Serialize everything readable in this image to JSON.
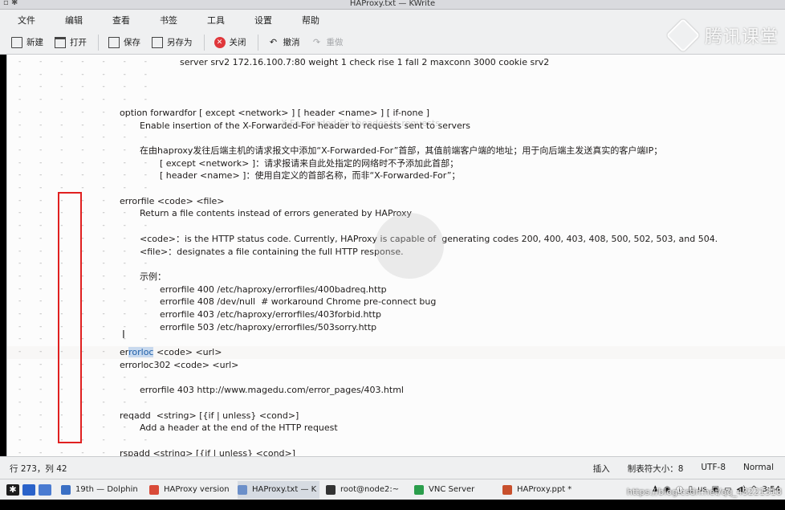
{
  "window": {
    "title": "HAProxy.txt — KWrite"
  },
  "menubar": [
    "文件",
    "编辑",
    "查看",
    "书签",
    "工具",
    "设置",
    "帮助"
  ],
  "toolbar": {
    "new": "新建",
    "open": "打开",
    "save": "保存",
    "save_as": "另存为",
    "close": "关闭",
    "undo": "撤消",
    "redo": "重做"
  },
  "watermark": "腾讯课堂",
  "editor_lines": [
    {
      "indent": 0,
      "text": "server srv2 172.16.100.7:80 weight 1 check rise 1 fall 2 maxconn 3000 cookie srv2",
      "pad": 215
    },
    {
      "indent": 0,
      "text": "",
      "pad": 0
    },
    {
      "indent": 0,
      "text": "",
      "pad": 0
    },
    {
      "indent": 0,
      "text": "",
      "pad": 0
    },
    {
      "indent": 0,
      "text": "option forwardfor [ except <network> ] [ header <name> ] [ if-none ]",
      "pad": 140
    },
    {
      "indent": 0,
      "text": "Enable insertion of the X-Forwarded-For header to requests sent to servers",
      "pad": 165
    },
    {
      "indent": 0,
      "text": "",
      "pad": 0
    },
    {
      "indent": 0,
      "text": "在由haproxy发往后端主机的请求报文中添加“X-Forwarded-For”首部，其值前端客户端的地址；用于向后端主发送真实的客户端IP；",
      "pad": 165
    },
    {
      "indent": 0,
      "text": "[ except <network> ]：请求报请来自此处指定的网络时不予添加此首部；",
      "pad": 190
    },
    {
      "indent": 0,
      "text": "[ header <name> ]：使用自定义的首部名称，而非“X-Forwarded-For”；",
      "pad": 190
    },
    {
      "indent": 0,
      "text": "",
      "pad": 0
    },
    {
      "indent": 0,
      "text": "errorfile <code> <file>",
      "pad": 140
    },
    {
      "indent": 0,
      "text": "Return a file contents instead of errors generated by HAProxy",
      "pad": 165
    },
    {
      "indent": 0,
      "text": "",
      "pad": 0
    },
    {
      "indent": 0,
      "text": "<code>：is the HTTP status code. Currently, HAProxy is capable of  generating codes 200, 400, 403, 408, 500, 502, 503, and 504.",
      "pad": 165
    },
    {
      "indent": 0,
      "text": "<file>：designates a file containing the full HTTP response.",
      "pad": 165
    },
    {
      "indent": 0,
      "text": "",
      "pad": 0
    },
    {
      "indent": 0,
      "text": "示例：",
      "pad": 165
    },
    {
      "indent": 0,
      "text": "errorfile 400 /etc/haproxy/errorfiles/400badreq.http",
      "pad": 190
    },
    {
      "indent": 0,
      "text": "errorfile 408 /dev/null  # workaround Chrome pre-connect bug",
      "pad": 190
    },
    {
      "indent": 0,
      "text": "errorfile 403 /etc/haproxy/errorfiles/403forbid.http",
      "pad": 190
    },
    {
      "indent": 0,
      "text": "errorfile 503 /etc/haproxy/errorfiles/503sorry.http",
      "pad": 190
    },
    {
      "indent": 0,
      "text": "",
      "pad": 0
    },
    {
      "indent": 0,
      "text": "",
      "pad": 140,
      "selected": true,
      "pre": "er",
      "sel": "rorloc",
      "post": " <code> <url>"
    },
    {
      "indent": 0,
      "text": "errorloc302 <code> <url>",
      "pad": 140
    },
    {
      "indent": 0,
      "text": "",
      "pad": 0
    },
    {
      "indent": 0,
      "text": "errorfile 403 http://www.magedu.com/error_pages/403.html",
      "pad": 165
    },
    {
      "indent": 0,
      "text": "",
      "pad": 0
    },
    {
      "indent": 0,
      "text": "reqadd  <string> [{if | unless} <cond>]",
      "pad": 140
    },
    {
      "indent": 0,
      "text": "Add a header at the end of the HTTP request",
      "pad": 165
    },
    {
      "indent": 0,
      "text": "",
      "pad": 0
    },
    {
      "indent": 0,
      "text": "rspadd <string> [{if | unless} <cond>]",
      "pad": 140
    }
  ],
  "overlay_text": "X-Forwarded-For header to requests",
  "statusbar": {
    "position": "行 273，列 42",
    "mode": "插入",
    "tab": "制表符大小：8",
    "encoding": "UTF-8",
    "style": "Normal"
  },
  "taskbar": {
    "tasks": [
      {
        "label": "19th — Dolphin",
        "color": "#3a6fc4"
      },
      {
        "label": "HAProxy version",
        "color": "#d94a38"
      },
      {
        "label": "HAProxy.txt — K",
        "color": "#6b8fc9",
        "active": true
      },
      {
        "label": "root@node2:~",
        "color": "#333333"
      },
      {
        "label": "VNC Server",
        "color": "#2b9e4c"
      },
      {
        "label": "HAProxy.ppt *",
        "color": "#c8502d"
      }
    ],
    "tray_lang": "us",
    "clock": "3:54"
  },
  "url_watermark": "https://blog.csdn.net/qq_43221318"
}
